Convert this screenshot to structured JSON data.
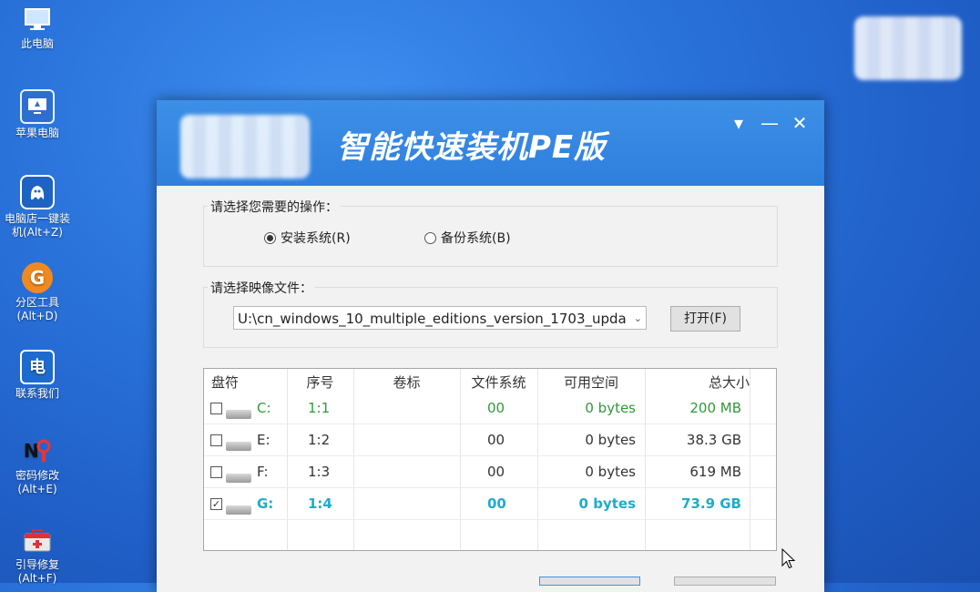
{
  "desktop": {
    "icons": [
      {
        "label": "此电脑",
        "icon": "monitor-icon"
      },
      {
        "label": "苹果电脑",
        "icon": "apple-monitor-icon"
      },
      {
        "label": "电脑店一键装机(Alt+Z)",
        "icon": "ghost-icon"
      },
      {
        "label": "分区工具(Alt+D)",
        "icon": "partition-g-icon"
      },
      {
        "label": "联系我们",
        "icon": "dian-badge-icon"
      },
      {
        "label": "密码修改(Alt+E)",
        "icon": "password-np-icon"
      },
      {
        "label": "引导修复(Alt+F)",
        "icon": "toolbox-icon"
      }
    ]
  },
  "window": {
    "title": "智能快速装机PE版",
    "controls": {
      "menu_glyph": "▾",
      "minimize_glyph": "—",
      "close_glyph": "✕"
    }
  },
  "operation": {
    "title": "请选择您需要的操作：",
    "options": [
      {
        "label": "安装系统(R)",
        "selected": true
      },
      {
        "label": "备份系统(B)",
        "selected": false
      }
    ]
  },
  "image_file": {
    "title": "请选择映像文件：",
    "path": "U:\\cn_windows_10_multiple_editions_version_1703_upda",
    "open_button": "打开(F)"
  },
  "partition_table": {
    "columns": [
      "盘符",
      "序号",
      "卷标",
      "文件系统",
      "可用空间",
      "总大小"
    ],
    "rows": [
      {
        "checked": false,
        "drive": "C:",
        "index": "1:1",
        "label": "",
        "fs": "00",
        "free": "0 bytes",
        "total": "200 MB",
        "style": "green"
      },
      {
        "checked": false,
        "drive": "E:",
        "index": "1:2",
        "label": "",
        "fs": "00",
        "free": "0 bytes",
        "total": "38.3 GB",
        "style": "normal"
      },
      {
        "checked": false,
        "drive": "F:",
        "index": "1:3",
        "label": "",
        "fs": "00",
        "free": "0 bytes",
        "total": "619 MB",
        "style": "normal"
      },
      {
        "checked": true,
        "drive": "G:",
        "index": "1:4",
        "label": "",
        "fs": "00",
        "free": "0 bytes",
        "total": "73.9 GB",
        "style": "cyan"
      }
    ]
  },
  "colors": {
    "accent": "#2f7fde",
    "green_row": "#2e9a38",
    "selected_row": "#22aacc"
  }
}
